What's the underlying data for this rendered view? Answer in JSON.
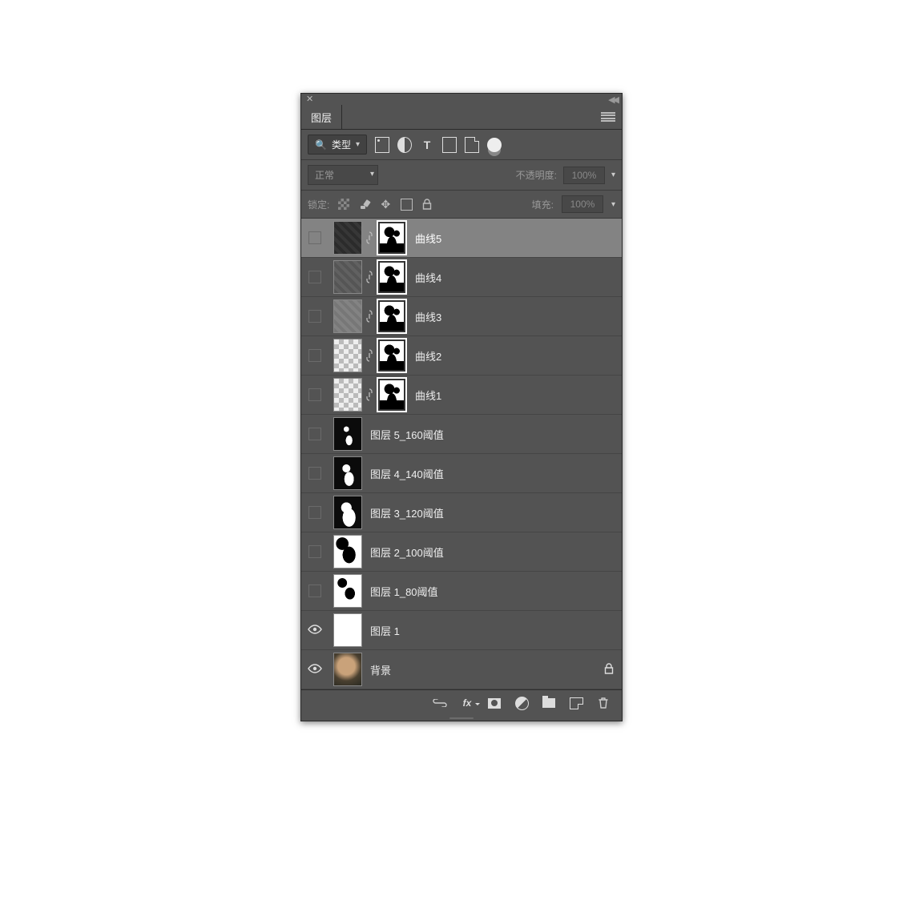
{
  "panel": {
    "tab_title": "图层",
    "filter": {
      "label": "类型",
      "search_icon": "search"
    },
    "blend": {
      "mode": "正常",
      "opacity_label": "不透明度:",
      "opacity_value": "100%"
    },
    "lock": {
      "label": "锁定:",
      "fill_label": "填充:",
      "fill_value": "100%"
    }
  },
  "layers": [
    {
      "name": "曲线5",
      "type": "adjustment",
      "visible": false,
      "selected": true,
      "pattern": "pattern-dark"
    },
    {
      "name": "曲线4",
      "type": "adjustment",
      "visible": false,
      "selected": false,
      "pattern": "pattern-gray"
    },
    {
      "name": "曲线3",
      "type": "adjustment",
      "visible": false,
      "selected": false,
      "pattern": "pattern-light"
    },
    {
      "name": "曲线2",
      "type": "adjustment",
      "visible": false,
      "selected": false,
      "pattern": "pattern-checker"
    },
    {
      "name": "曲线1",
      "type": "adjustment",
      "visible": false,
      "selected": false,
      "pattern": "pattern-checker"
    },
    {
      "name": "图层 5_160阈值",
      "type": "threshold",
      "visible": false,
      "selected": false,
      "tclass": "t1"
    },
    {
      "name": "图层 4_140阈值",
      "type": "threshold",
      "visible": false,
      "selected": false,
      "tclass": "t2"
    },
    {
      "name": "图层 3_120阈值",
      "type": "threshold",
      "visible": false,
      "selected": false,
      "tclass": "t3"
    },
    {
      "name": "图层 2_100阈值",
      "type": "threshold",
      "visible": false,
      "selected": false,
      "tclass": "t4"
    },
    {
      "name": "图层 1_80阈值",
      "type": "threshold",
      "visible": false,
      "selected": false,
      "tclass": "t5"
    },
    {
      "name": "图层 1",
      "type": "solid-white",
      "visible": true,
      "selected": false
    },
    {
      "name": "背景",
      "type": "background",
      "visible": true,
      "selected": false,
      "locked": true
    }
  ]
}
